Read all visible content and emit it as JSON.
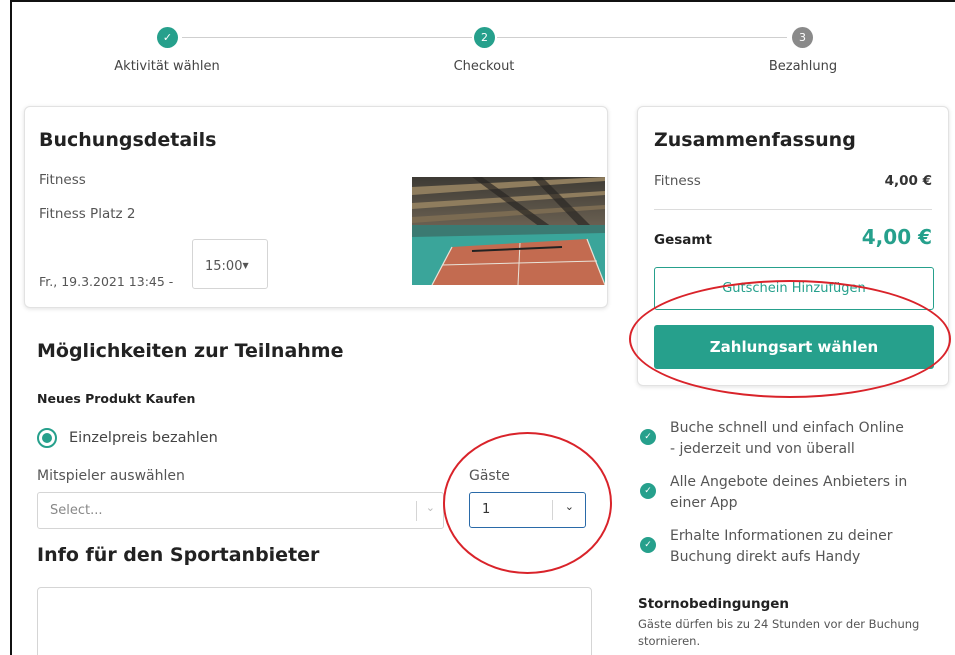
{
  "stepper": {
    "steps": [
      {
        "label": "Aktivität wählen",
        "marker": "✓",
        "state": "done"
      },
      {
        "label": "Checkout",
        "marker": "2",
        "state": "active"
      },
      {
        "label": "Bezahlung",
        "marker": "3",
        "state": "pending"
      }
    ]
  },
  "booking": {
    "title": "Buchungsdetails",
    "activity": "Fitness",
    "location": "Fitness Platz 2",
    "datetime": "Fr., 19.3.2021 13:45 -",
    "end_time": "15:00"
  },
  "summary": {
    "title": "Zusammenfassung",
    "item_label": "Fitness",
    "item_price": "4,00 €",
    "total_label": "Gesamt",
    "total_price": "4,00 €",
    "voucher_button": "Gutschein Hinzufügen",
    "pay_button": "Zahlungsart wählen"
  },
  "participation": {
    "title": "Möglichkeiten zur Teilnahme",
    "subtitle": "Neues Produkt Kaufen",
    "radio_label": "Einzelpreis bezahlen",
    "players_label": "Mitspieler auswählen",
    "players_placeholder": "Select...",
    "guests_label": "Gäste",
    "guests_value": "1"
  },
  "info": {
    "title": "Info für den Sportanbieter"
  },
  "perks": [
    {
      "line1": "Buche schnell und einfach Online",
      "line2": "- jederzeit und von überall"
    },
    {
      "line1": "Alle Angebote deines Anbieters in",
      "line2": "einer App"
    },
    {
      "line1": "Erhalte Informationen zu deiner",
      "line2": "Buchung direkt aufs Handy"
    }
  ],
  "storno": {
    "title": "Stornobedingungen",
    "text": "Gäste dürfen bis zu 24 Stunden vor der Buchung stornieren."
  },
  "colors": {
    "accent": "#26a08c",
    "annotation": "#d9232a"
  }
}
